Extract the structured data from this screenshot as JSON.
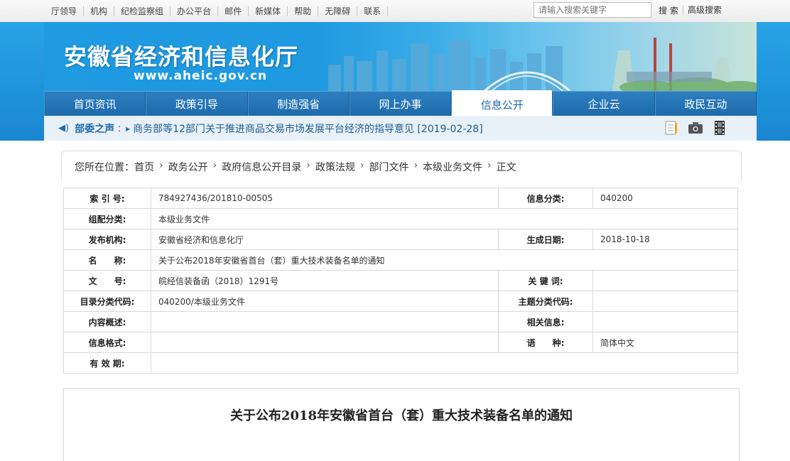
{
  "topbar": {
    "links": [
      "厅领导",
      "机构",
      "纪检监察组",
      "办公平台",
      "邮件",
      "新媒体",
      "帮助",
      "无障碍",
      "联系"
    ],
    "search_placeholder": "请输入搜索关键字",
    "search_btn": "搜 索",
    "advanced": "高级搜索"
  },
  "header": {
    "title": "安徽省经济和信息化厅",
    "url": "www.aheic.gov.cn"
  },
  "nav": [
    "首页资讯",
    "政策引导",
    "制造强省",
    "网上办事",
    "信息公开",
    "企业云",
    "政民互动"
  ],
  "nav_active": "信息公开",
  "notice": {
    "label": "部委之声",
    "text": "商务部等12部门关于推进商品交易市场发展平台经济的指导意见 [2019-02-28]"
  },
  "breadcrumb": {
    "prefix": "您所在位置：",
    "items": [
      "首页",
      "政务公开",
      "政府信息公开目录",
      "政策法规",
      "部门文件",
      "本级业务文件",
      "正文"
    ]
  },
  "info": {
    "index_label": "索 引 号:",
    "index": "784927436/201810-00505",
    "cat_label": "信息分类:",
    "cat": "040200",
    "group_label": "组配分类:",
    "group": "本级业务文件",
    "org_label": "发布机构:",
    "org": "安徽省经济和信息化厅",
    "date_label": "生成日期:",
    "date": "2018-10-18",
    "name_label": "名　　称:",
    "name": "关于公布2018年安徽省首台（套）重大技术装备名单的通知",
    "docno_label": "文　　号:",
    "docno": "皖经信装备函（2018）1291号",
    "keyword_label": "关 键 词:",
    "keyword": "",
    "code_label": "目录分类代码:",
    "code": "040200/本级业务文件",
    "topic_label": "主题分类代码:",
    "topic": "",
    "summary_label": "内容概述:",
    "summary": "",
    "related_label": "相关信息:",
    "related": "",
    "format_label": "信息格式:",
    "format": "",
    "lang_label": "语　　种:",
    "lang": "简体中文",
    "valid_label": "有 效 期:",
    "valid": ""
  },
  "article": {
    "title": "关于公布2018年安徽省首台（套）重大技术装备名单的通知"
  }
}
